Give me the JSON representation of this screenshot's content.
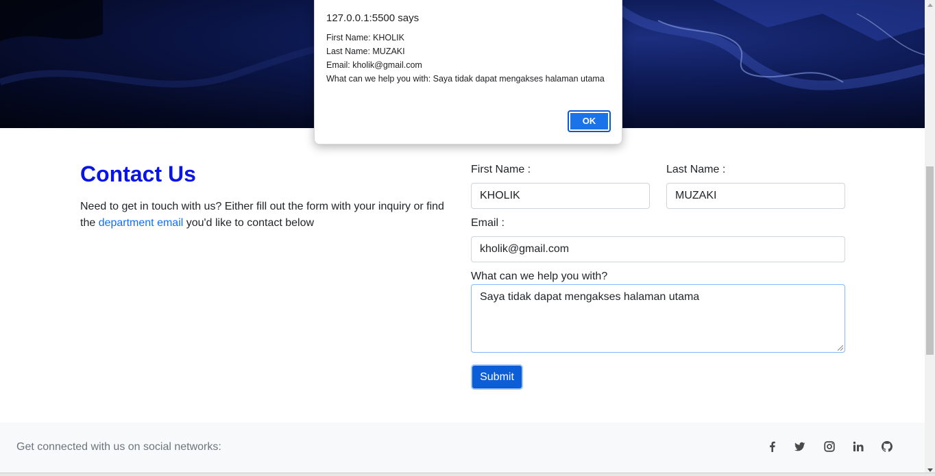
{
  "contact": {
    "title": "Contact Us",
    "desc_before": "Need to get in touch with us? Either fill out the form with your inquiry or find the ",
    "desc_link": "department email",
    "desc_after": " you'd like to contact below"
  },
  "form": {
    "first_name_label": "First Name :",
    "first_name_value": "KHOLIK",
    "last_name_label": "Last Name :",
    "last_name_value": "MUZAKI",
    "email_label": "Email :",
    "email_value": "kholik@gmail.com",
    "help_label": "What can we help you with?",
    "help_value": "Saya tidak dapat mengakses halaman utama",
    "submit_label": "Submit"
  },
  "footer": {
    "text": "Get connected with us on social networks:",
    "icons": [
      "facebook-icon",
      "twitter-icon",
      "instagram-icon",
      "linkedin-icon",
      "github-icon"
    ]
  },
  "dialog": {
    "title": "127.0.0.1:5500 says",
    "lines": [
      "First Name: KHOLIK",
      "Last Name: MUZAKI",
      "Email: kholik@gmail.com",
      "What can we help you with: Saya tidak dapat mengakses halaman utama"
    ],
    "ok_label": "OK"
  },
  "colors": {
    "title": "#0a14e6",
    "link": "#0d6efd",
    "submit": "#0b5ed7",
    "ok_button": "#1a73e8",
    "hero": "#0d1a55"
  }
}
